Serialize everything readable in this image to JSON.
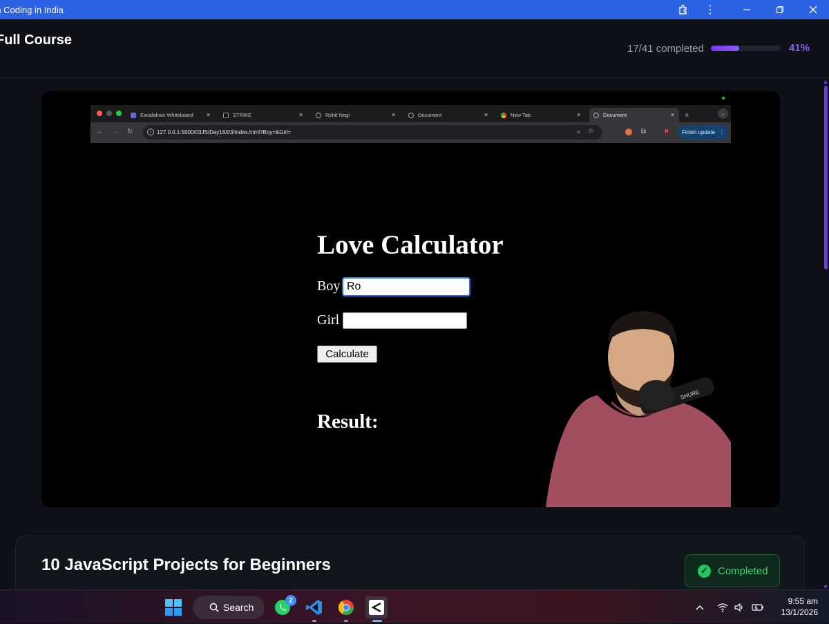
{
  "window": {
    "title": "rn Coding in India"
  },
  "course": {
    "title": "Full Course",
    "progress_text": "17/41 completed",
    "progress_fraction": 0.41,
    "progress_pct": "41%"
  },
  "embedded_browser": {
    "tabs": [
      {
        "label": "Excalidraw Whiteboard",
        "icon": "excalidraw-icon"
      },
      {
        "label": "STRIKE",
        "icon": "strike-icon"
      },
      {
        "label": "Rohit Negi",
        "icon": "globe-icon"
      },
      {
        "label": "Document",
        "icon": "globe-icon"
      },
      {
        "label": "New Tab",
        "icon": "chrome-icon"
      },
      {
        "label": "Document",
        "icon": "globe-icon",
        "active": true
      }
    ],
    "url": "127.0.0.1:5500/03JS/Day16/03/index.html?Boy=&Girl=",
    "profile_initial": "R",
    "finish_update_label": "Finish update"
  },
  "love_calculator": {
    "title": "Love Calculator",
    "boy_label": "Boy",
    "boy_value": "Ro",
    "girl_label": "Girl",
    "girl_value": "",
    "button_label": "Calculate",
    "result_label": "Result:"
  },
  "project_card": {
    "title": "10 JavaScript Projects for Beginners",
    "status_label": "Completed"
  },
  "taskbar": {
    "search_label": "Search",
    "whatsapp_badge": "2",
    "time": "9:55 am",
    "date": "13/1/2026"
  },
  "colors": {
    "titlebar": "#2b63e4",
    "accent_purple": "#8b5cf6",
    "success_green": "#22c55e"
  }
}
